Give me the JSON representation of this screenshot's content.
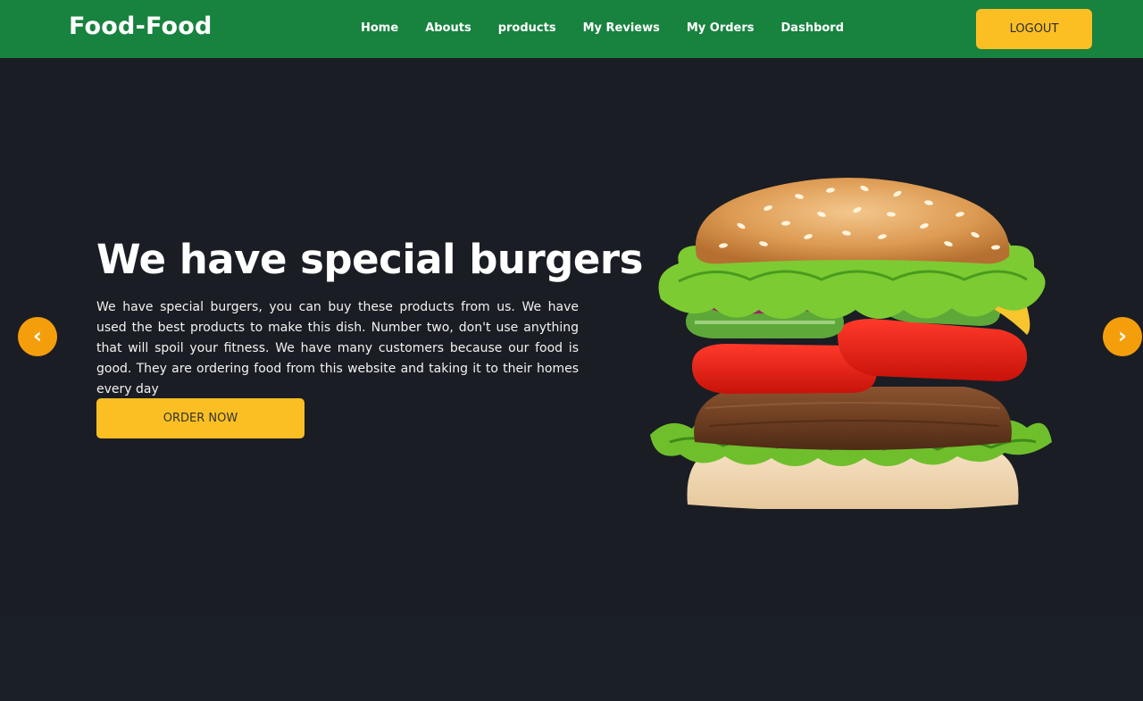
{
  "navbar": {
    "logo": "Food-Food",
    "links": [
      "Home",
      "Abouts",
      "products",
      "My Reviews",
      "My Orders",
      "Dashbord"
    ],
    "logout_label": "LOGOUT"
  },
  "hero": {
    "title": "We have special burgers",
    "text": "We have special burgers, you can buy these products from us. We have used the best products to make this dish. Number two, don't use anything that will spoil your fitness. We have many customers because our food is good. They are ordering food from this website and taking it to their homes every day",
    "cta_label": "ORDER NOW",
    "prev_arrow": "‹",
    "next_arrow": "›"
  },
  "colors": {
    "navbar": "#18823f",
    "accent": "#fbbf24",
    "hero_bg": "#1a1d24"
  },
  "icons": {
    "prev": "chevron-left-icon",
    "next": "chevron-right-icon"
  }
}
